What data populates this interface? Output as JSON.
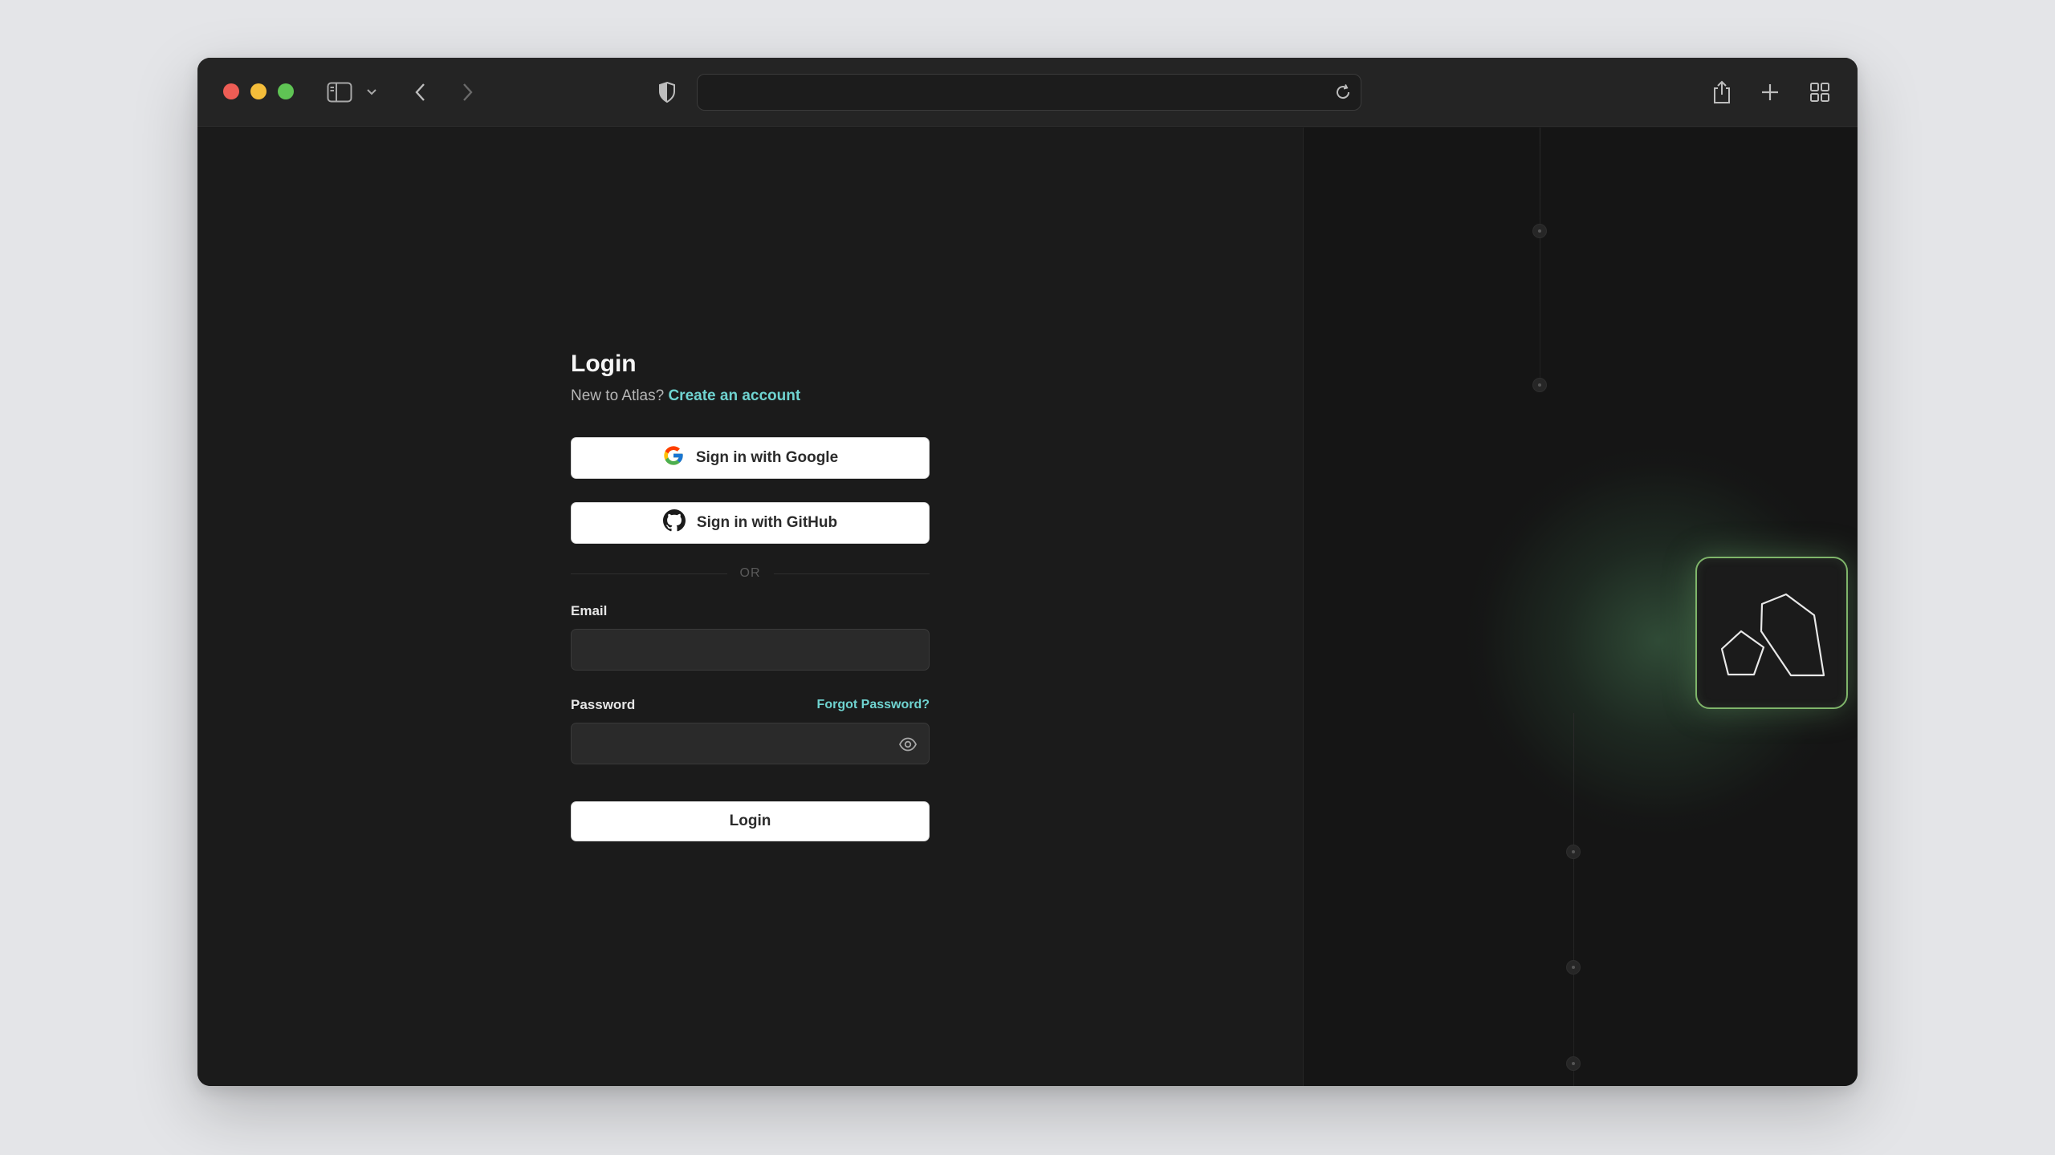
{
  "browser": {
    "toolbar_icons": [
      "sidebar-icon",
      "chevron-down-icon",
      "back-icon",
      "forward-icon",
      "shield-icon",
      "reload-icon",
      "share-icon",
      "new-tab-icon",
      "tab-overview-icon"
    ],
    "url": ""
  },
  "login": {
    "title": "Login",
    "subtitle_prefix": "New to Atlas?",
    "create_account_link": "Create an account",
    "google_button": "Sign in with Google",
    "github_button": "Sign in with GitHub",
    "divider_text": "OR",
    "email_label": "Email",
    "email_value": "",
    "password_label": "Password",
    "password_value": "",
    "forgot_password_link": "Forgot Password?",
    "submit_button": "Login"
  },
  "colors": {
    "accent_link": "#6fd3d0",
    "logo_border": "#7fb56a",
    "background": "#1b1b1b"
  }
}
